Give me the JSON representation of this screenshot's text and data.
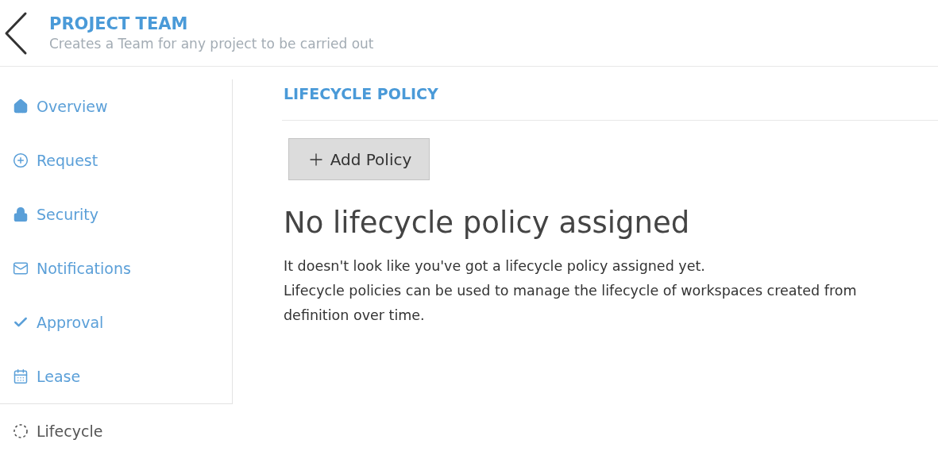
{
  "header": {
    "title": "PROJECT TEAM",
    "subtitle": "Creates a Team for any project to be carried out"
  },
  "sidebar": {
    "items": [
      {
        "label": "Overview",
        "selected": false
      },
      {
        "label": "Request",
        "selected": false
      },
      {
        "label": "Security",
        "selected": false
      },
      {
        "label": "Notifications",
        "selected": false
      },
      {
        "label": "Approval",
        "selected": false
      },
      {
        "label": "Lease",
        "selected": false
      },
      {
        "label": "Lifecycle",
        "selected": true
      }
    ]
  },
  "main": {
    "section_title": "LIFECYCLE POLICY",
    "add_button": "Add Policy",
    "empty_title": "No lifecycle policy assigned",
    "empty_lines": [
      "It doesn't look like you've got a lifecycle policy assigned yet.",
      "Lifecycle policies can be used to manage the lifecycle of workspaces created from",
      "definition over time."
    ]
  }
}
